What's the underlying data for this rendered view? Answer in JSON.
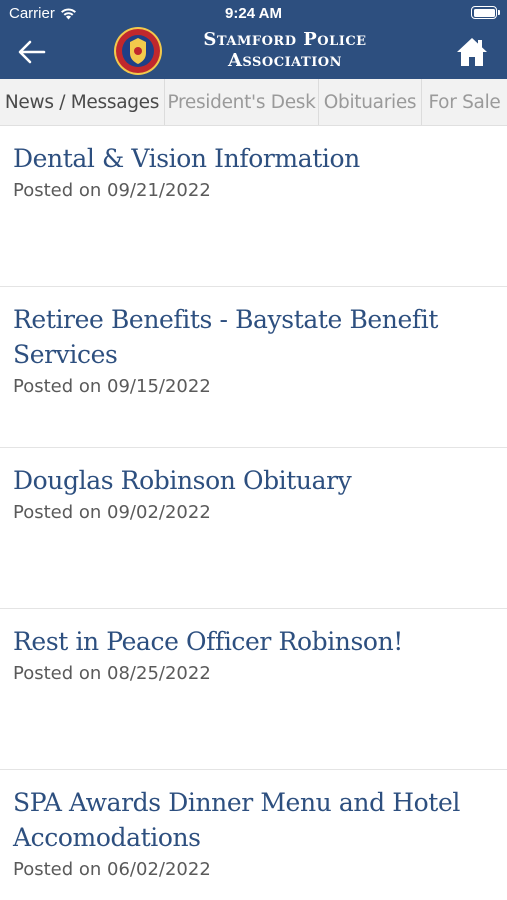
{
  "status_bar": {
    "carrier": "Carrier",
    "time": "9:24 AM",
    "icons": [
      "wifi-icon",
      "battery-icon"
    ]
  },
  "header": {
    "title_line1": "Stamford Police",
    "title_line2": "Association",
    "back_icon": "arrow-left-icon",
    "home_icon": "home-icon",
    "logo": "police-badge-logo",
    "background_color": "#2d4f7f"
  },
  "tabs": [
    {
      "label": "News / Messages",
      "active": true
    },
    {
      "label": "President's Desk",
      "active": false
    },
    {
      "label": "Obituaries",
      "active": false
    },
    {
      "label": "For Sale",
      "active": false
    }
  ],
  "posts": [
    {
      "title": "Dental & Vision Information",
      "date": "Posted on 09/21/2022"
    },
    {
      "title": "Retiree Benefits - Baystate Benefit Services",
      "date": "Posted on 09/15/2022"
    },
    {
      "title": "Douglas Robinson Obituary",
      "date": "Posted on 09/02/2022"
    },
    {
      "title": "Rest in Peace Officer Robinson!",
      "date": "Posted on 08/25/2022"
    },
    {
      "title": "SPA Awards Dinner Menu and Hotel Accomodations",
      "date": "Posted on 06/02/2022"
    }
  ],
  "colors": {
    "accent": "#2d4f7f",
    "tab_bar": "#f2f2f2"
  }
}
